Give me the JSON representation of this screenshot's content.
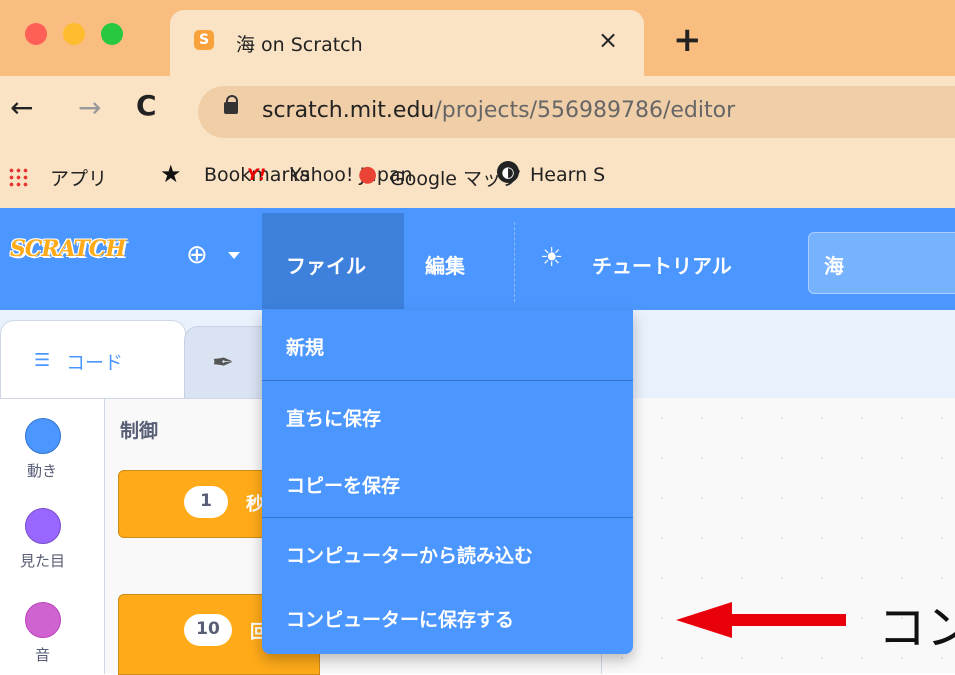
{
  "browser": {
    "tab_title": "海 on Scratch",
    "tab_close": "×",
    "new_tab": "+",
    "favicon": "S",
    "url_host": "scratch.mit.edu",
    "url_path": "/projects/556989786/editor",
    "nav": {
      "back": "←",
      "forward": "→",
      "reload": "C"
    },
    "bookmarks": [
      {
        "label": "アプリ",
        "icon": "apps-grid-icon"
      },
      {
        "label": "Bookmarks",
        "icon": "star-icon"
      },
      {
        "label": "Yahoo! Japan",
        "icon": "yahoo-icon",
        "icon_text": "Y!"
      },
      {
        "label": "Google マップ",
        "icon": "maps-pin-icon"
      },
      {
        "label": "Hearn S",
        "icon": "globe-icon"
      }
    ],
    "colors": {
      "tabbar": "#f9bd80",
      "toolbar": "#fae2c4"
    }
  },
  "scratch": {
    "logo": "SCRATCH",
    "menu": {
      "file": "ファイル",
      "edit": "編集",
      "tutorials": "チュートリアル"
    },
    "project_title": "海",
    "tabs": {
      "code": "コード"
    },
    "categories": [
      {
        "label": "動き",
        "color": "#4c97ff"
      },
      {
        "label": "見た目",
        "color": "#9966ff"
      },
      {
        "label": "音",
        "color": "#cf63cf"
      }
    ],
    "palette_heading": "制御",
    "blocks": [
      {
        "input": "1",
        "text": "秒"
      },
      {
        "input": "10",
        "text": "回"
      }
    ],
    "file_menu_items": [
      "新規",
      "直ちに保存",
      "コピーを保存",
      "コンピューターから読み込む",
      "コンピューターに保存する"
    ],
    "colors": {
      "menubar": "#4c97ff",
      "menu_active": "#3d81dd",
      "block": "#ffab19"
    }
  },
  "annotation": {
    "text": "コン",
    "arrow_color": "#e8000b"
  }
}
